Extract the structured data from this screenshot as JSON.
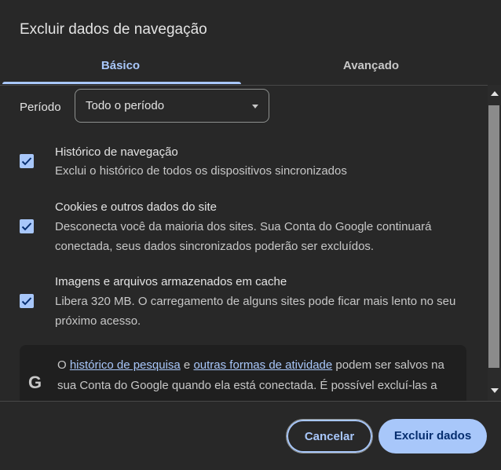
{
  "dialog": {
    "title": "Excluir dados de navegação",
    "tabs": [
      {
        "label": "Básico",
        "active": true
      },
      {
        "label": "Avançado",
        "active": false
      }
    ],
    "period": {
      "label": "Período",
      "selected": "Todo o período"
    },
    "items": [
      {
        "title": "Histórico de navegação",
        "description": "Exclui o histórico de todos os dispositivos sincronizados",
        "checked": true
      },
      {
        "title": "Cookies e outros dados do site",
        "description": "Desconecta você da maioria dos sites. Sua Conta do Google continuará conectada, seus dados sincronizados poderão ser excluídos.",
        "checked": true
      },
      {
        "title": "Imagens e arquivos armazenados em cache",
        "description": "Libera 320 MB. O carregamento de alguns sites pode ficar mais lento no seu próximo acesso.",
        "checked": true
      }
    ],
    "info": {
      "icon": "google-g-icon",
      "prefix": "O ",
      "link1": "histórico de pesquisa",
      "middle": " e ",
      "link2": "outras formas de atividade",
      "suffix": " podem ser salvos na sua Conta do Google quando ela está conectada. É possível excluí-las a qualquer momento."
    },
    "buttons": {
      "cancel": "Cancelar",
      "delete": "Excluir dados"
    },
    "colors": {
      "accent": "#a8c7fa",
      "background": "#282828",
      "button_text": "#062e6f"
    }
  }
}
